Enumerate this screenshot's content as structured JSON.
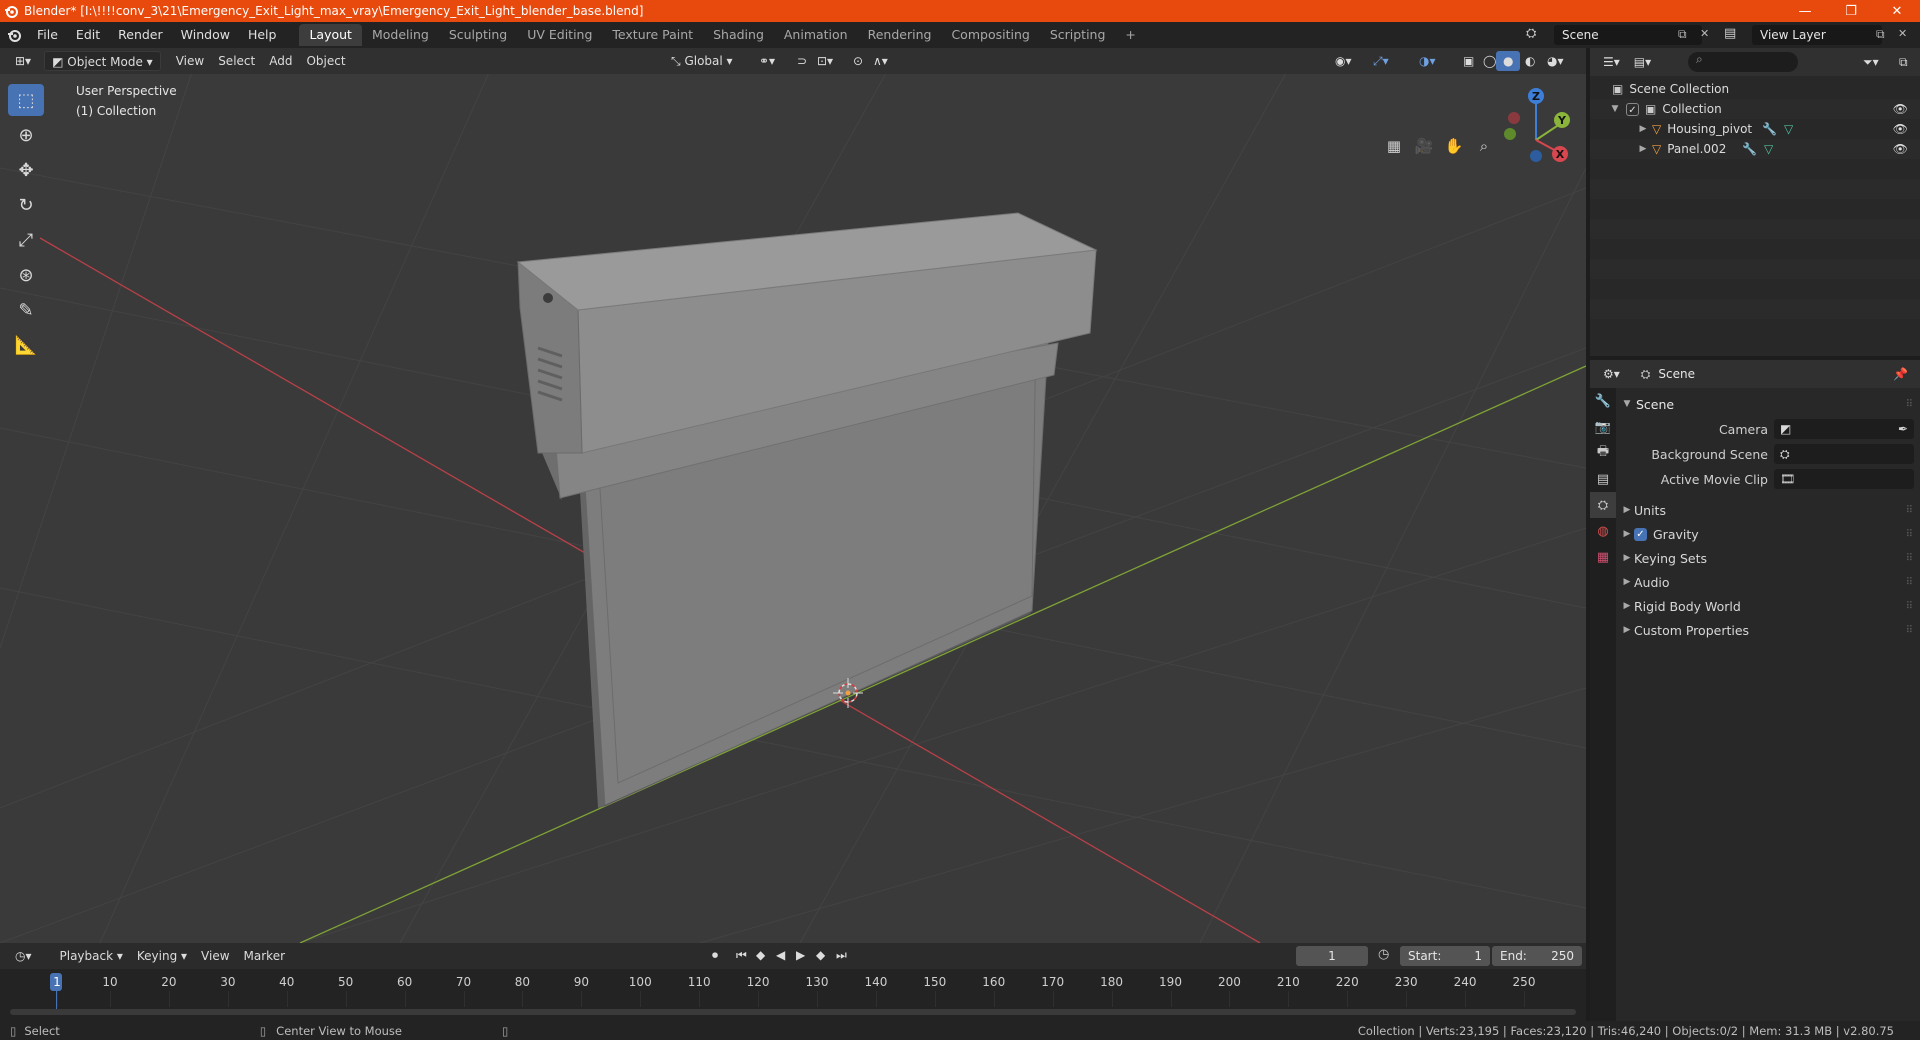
{
  "window": {
    "title": "Blender* [I:\\!!!!conv_3\\21\\Emergency_Exit_Light_max_vray\\Emergency_Exit_Light_blender_base.blend]",
    "minimize": "—",
    "maximize": "❐",
    "close": "✕"
  },
  "menu": [
    "File",
    "Edit",
    "Render",
    "Window",
    "Help"
  ],
  "workspaces": [
    "Layout",
    "Modeling",
    "Sculpting",
    "UV Editing",
    "Texture Paint",
    "Shading",
    "Animation",
    "Rendering",
    "Compositing",
    "Scripting"
  ],
  "workspace_add": "+",
  "scene_name": "Scene",
  "view_layer_name": "View Layer",
  "viewport": {
    "mode": "Object Mode",
    "menus": [
      "View",
      "Select",
      "Add",
      "Object"
    ],
    "transform_orientation": "Global",
    "perspective_label": "User Perspective",
    "collection_label": "(1) Collection",
    "gizmo": {
      "z": "Z",
      "y": "Y",
      "x": "X"
    }
  },
  "timeline": {
    "menus": [
      "Playback",
      "Keying",
      "View",
      "Marker"
    ],
    "current_frame": "1",
    "start_label": "Start:",
    "start_value": "1",
    "end_label": "End:",
    "end_value": "250",
    "ruler": [
      "1",
      "10",
      "20",
      "30",
      "40",
      "50",
      "60",
      "70",
      "80",
      "90",
      "100",
      "110",
      "120",
      "130",
      "140",
      "150",
      "160",
      "170",
      "180",
      "190",
      "200",
      "210",
      "220",
      "230",
      "240",
      "250"
    ]
  },
  "statusbar": {
    "select": "Select",
    "center_view": "Center View to Mouse",
    "stats": "Collection | Verts:23,195 | Faces:23,120 | Tris:46,240 | Objects:0/2 | Mem: 31.3 MB | v2.80.75"
  },
  "outliner": {
    "root": "Scene Collection",
    "collection": "Collection",
    "objects": [
      "Housing_pivot",
      "Panel.002"
    ]
  },
  "properties": {
    "context": "Scene",
    "panel_title": "Scene",
    "camera_label": "Camera",
    "background_scene_label": "Background Scene",
    "active_clip_label": "Active Movie Clip",
    "sections": [
      "Units",
      "Gravity",
      "Keying Sets",
      "Audio",
      "Rigid Body World",
      "Custom Properties"
    ]
  },
  "colors": {
    "accent": "#4772b3",
    "titlebar": "#e8490d",
    "x_axis": "#d8474f",
    "y_axis": "#8bb43b",
    "z_axis": "#3d7fd8",
    "object_icon": "#f0a040"
  }
}
